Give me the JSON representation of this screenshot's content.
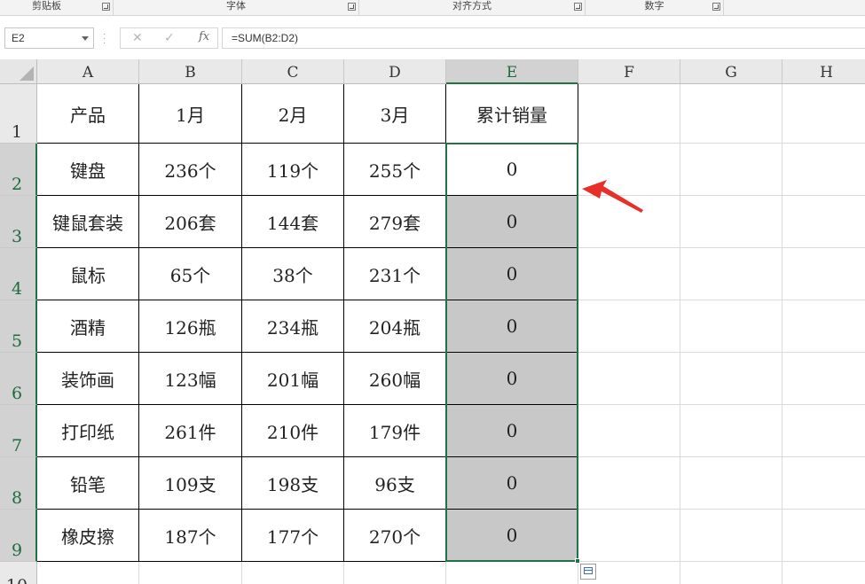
{
  "ribbon": {
    "groups": [
      {
        "label": "剪贴板"
      },
      {
        "label": "字体"
      },
      {
        "label": "对齐方式"
      },
      {
        "label": "数字"
      }
    ]
  },
  "formula_bar": {
    "name_box": "E2",
    "formula": "=SUM(B2:D2)",
    "cancel_icon": "close-icon",
    "enter_icon": "check-icon",
    "fx_label": "fx"
  },
  "sheet": {
    "columns": [
      "A",
      "B",
      "C",
      "D",
      "E",
      "F",
      "G",
      "H"
    ],
    "rows": [
      "1",
      "2",
      "3",
      "4",
      "5",
      "6",
      "7",
      "8",
      "9",
      "10"
    ],
    "selected_column": "E",
    "selected_cell": "E2",
    "cells": [
      [
        "产品",
        "1月",
        "2月",
        "3月",
        "累计销量"
      ],
      [
        "键盘",
        "236个",
        "119个",
        "255个",
        "0"
      ],
      [
        "键鼠套装",
        "206套",
        "144套",
        "279套",
        "0"
      ],
      [
        "鼠标",
        "65个",
        "38个",
        "231个",
        "0"
      ],
      [
        "酒精",
        "126瓶",
        "234瓶",
        "204瓶",
        "0"
      ],
      [
        "装饰画",
        "123幅",
        "201幅",
        "260幅",
        "0"
      ],
      [
        "打印纸",
        "261件",
        "210件",
        "179件",
        "0"
      ],
      [
        "铅笔",
        "109支",
        "198支",
        "96支",
        "0"
      ],
      [
        "橡皮擦",
        "187个",
        "177个",
        "270个",
        "0"
      ]
    ]
  },
  "colors": {
    "selection": "#217346",
    "shaded_fill": "#c8c8c8",
    "annotation_arrow": "#e8302a"
  }
}
